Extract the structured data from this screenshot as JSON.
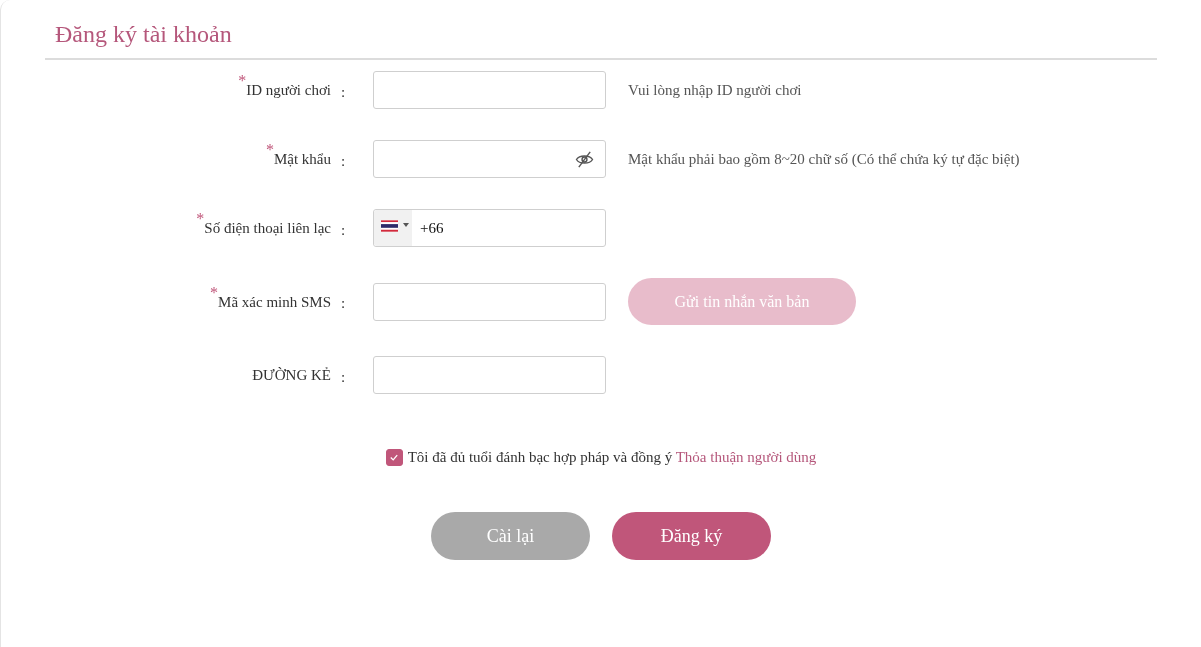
{
  "title": "Đăng ký tài khoản",
  "fields": [
    {
      "kind": "text",
      "required_mark": "*",
      "label": "ID người chơi",
      "separator": ":",
      "hint": "Vui lòng nhập ID người chơi"
    },
    {
      "kind": "password",
      "required_mark": "*",
      "label": "Mật khẩu",
      "separator": ":",
      "password_visible": false,
      "hint": "Mật khẩu phải bao gồm 8~20 chữ số (Có thể chứa ký tự đặc biệt)"
    },
    {
      "kind": "phone",
      "required_mark": "*",
      "label": "Số điện thoại liên lạc",
      "separator": ":",
      "value": "+66"
    },
    {
      "kind": "sms",
      "required_mark": "*",
      "label": "Mã xác minh SMS",
      "separator": ":",
      "action": {
        "label": "Gửi tin nhắn văn bản",
        "disabled": true
      }
    },
    {
      "kind": "text",
      "label": "ĐƯỜNG KẺ",
      "separator": ":"
    }
  ],
  "agreement": {
    "checked": true,
    "text": "Tôi đã đủ tuổi đánh bạc hợp pháp và đồng ý",
    "link": "Thỏa thuận người dùng"
  },
  "buttons": [
    {
      "kind": "reset",
      "label": "Cài lại"
    },
    {
      "kind": "submit",
      "label": "Đăng ký"
    }
  ]
}
